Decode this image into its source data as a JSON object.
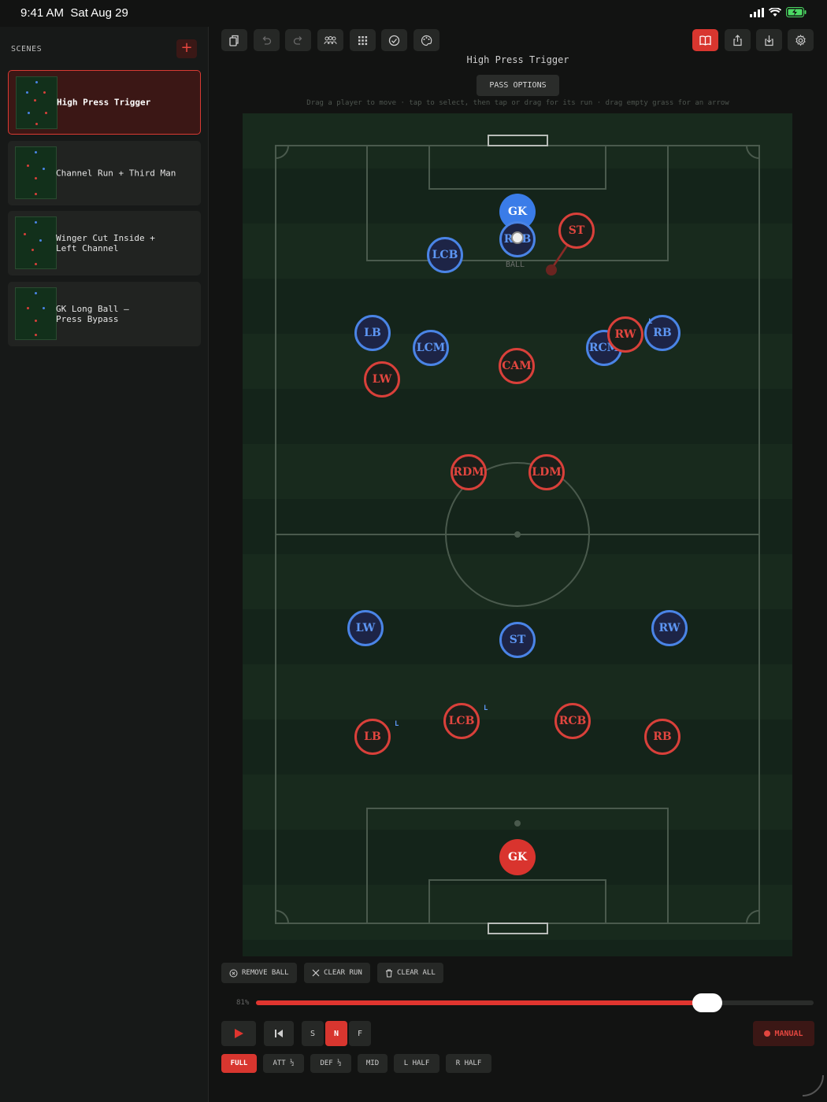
{
  "status": {
    "time": "9:41 AM",
    "date": "Sat Aug 29"
  },
  "sidebar": {
    "header": "SCENES",
    "add_label": "+",
    "scenes": [
      {
        "title": "High Press Trigger",
        "active": true
      },
      {
        "title": "Channel Run + Third Man",
        "active": false
      },
      {
        "title": "Winger Cut Inside +\nLeft Channel",
        "active": false
      },
      {
        "title": "GK Long Ball —\nPress Bypass",
        "active": false
      }
    ]
  },
  "toolbar": {
    "left_icons": [
      "copy-icon",
      "undo-icon",
      "redo-icon",
      "players-icon",
      "grid-icon",
      "check-icon",
      "palette-icon"
    ],
    "right_icons": [
      "book-icon",
      "share-icon",
      "download-icon",
      "settings-icon"
    ]
  },
  "scene_title": "High Press Trigger",
  "pass_options_label": "PASS OPTIONS",
  "hint": "Drag a player to move · tap to select, then tap or drag for its run · drag empty grass for an arrow",
  "ball_label": "BALL",
  "players_blue": [
    {
      "label": "GK"
    },
    {
      "label": "RCB"
    },
    {
      "label": "LCB"
    },
    {
      "label": "LB"
    },
    {
      "label": "LCM"
    },
    {
      "label": "RCM"
    },
    {
      "label": "RB"
    },
    {
      "label": "LW"
    },
    {
      "label": "ST"
    },
    {
      "label": "RW"
    }
  ],
  "players_red": [
    {
      "label": "ST"
    },
    {
      "label": "CAM"
    },
    {
      "label": "LW"
    },
    {
      "label": "RW"
    },
    {
      "label": "RDM"
    },
    {
      "label": "LDM"
    },
    {
      "label": "LCB"
    },
    {
      "label": "RCB"
    },
    {
      "label": "LB"
    },
    {
      "label": "RB"
    },
    {
      "label": "GK"
    }
  ],
  "tags": [
    "L",
    "L",
    "L"
  ],
  "actions": {
    "remove_ball": "REMOVE BALL",
    "clear_run": "CLEAR RUN",
    "clear_all": "CLEAR ALL"
  },
  "playback": {
    "speed_percent_label": "81%",
    "speed_fraction": 0.81,
    "speeds": [
      "S",
      "N",
      "F"
    ],
    "active_speed": "N",
    "mode_label": "MANUAL"
  },
  "zones": [
    "FULL",
    "ATT ½",
    "DEF ½",
    "MID",
    "L HALF",
    "R HALF"
  ],
  "active_zone": "FULL",
  "colors": {
    "accent_red": "#d8362f",
    "team_blue": "#4a84e6",
    "team_red": "#d9403a",
    "pitch": "#14241a"
  }
}
